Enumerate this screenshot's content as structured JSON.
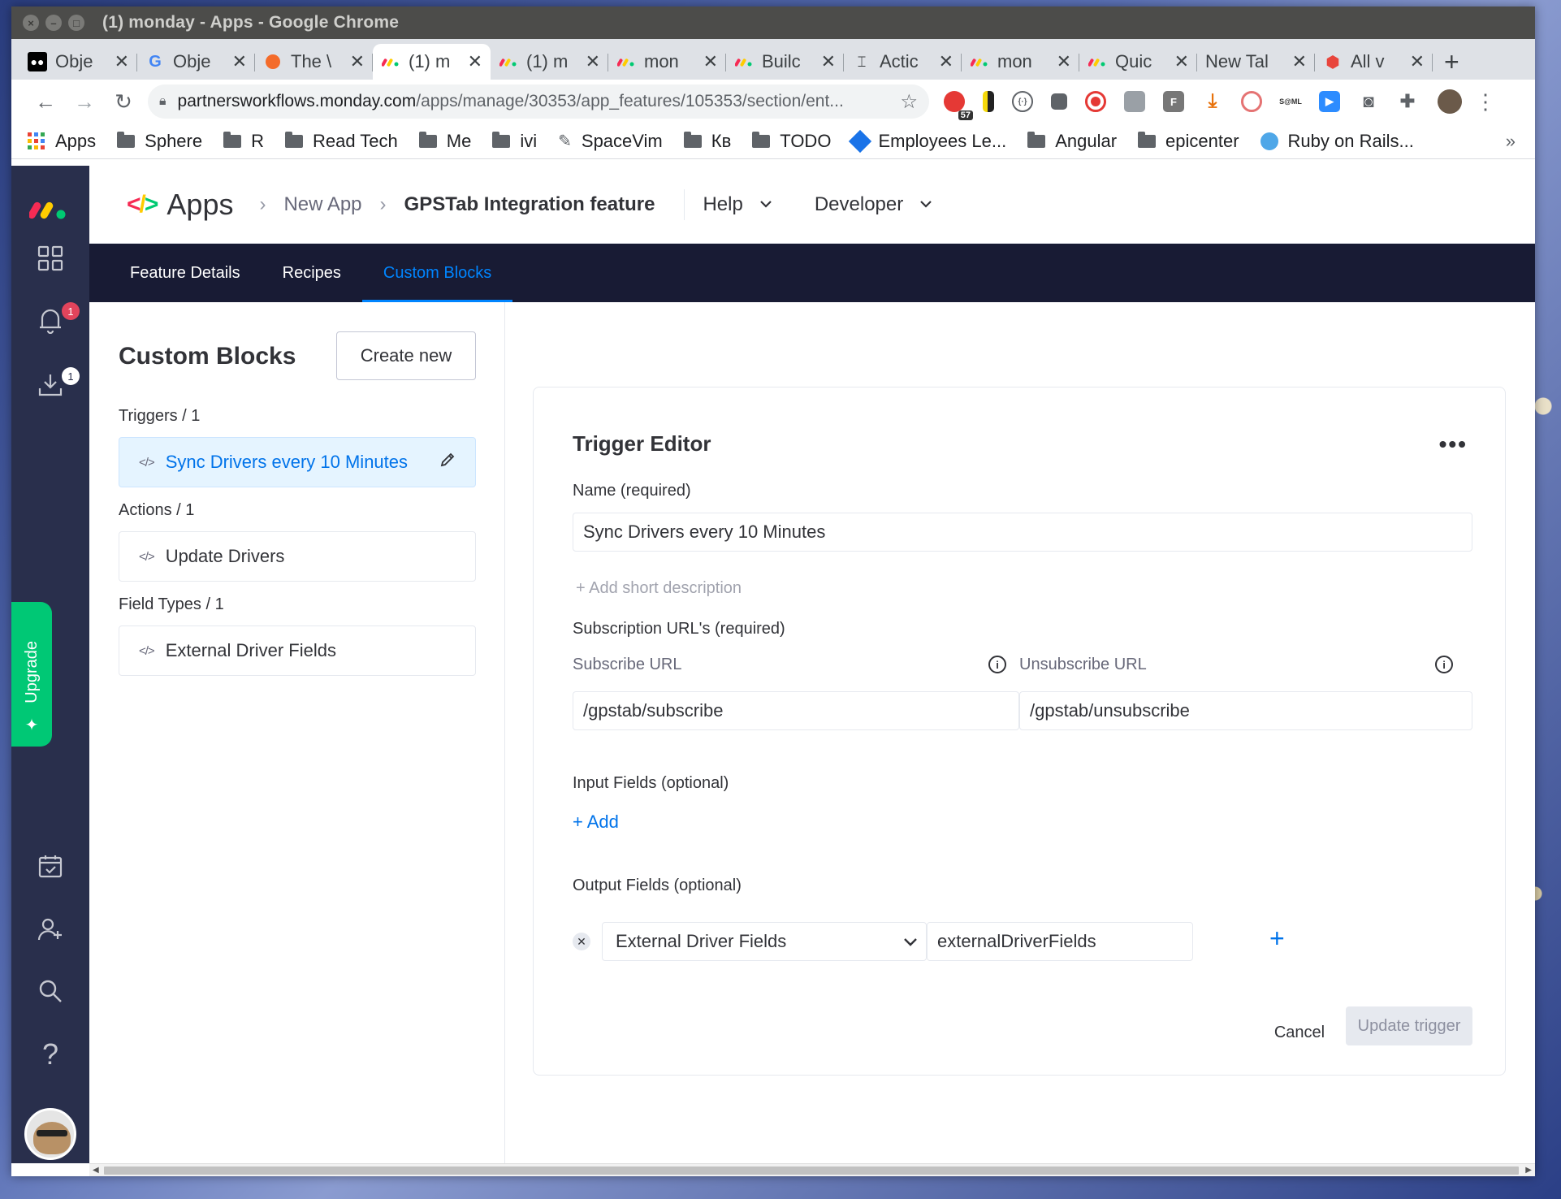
{
  "window": {
    "title": "(1) monday - Apps - Google Chrome"
  },
  "tabs": [
    {
      "label": "Obje",
      "icon": "medium-icon",
      "active": false
    },
    {
      "label": "Obje",
      "icon": "google-icon",
      "active": false
    },
    {
      "label": "The \\",
      "icon": "the-icon",
      "active": false
    },
    {
      "label": "(1) m",
      "icon": "monday-icon",
      "active": true
    },
    {
      "label": "(1) m",
      "icon": "monday-icon",
      "active": false
    },
    {
      "label": "mon",
      "icon": "monday-icon",
      "active": false
    },
    {
      "label": "Builc",
      "icon": "monday-icon",
      "active": false
    },
    {
      "label": "Actic",
      "icon": "action-icon",
      "active": false
    },
    {
      "label": "mon",
      "icon": "monday-icon",
      "active": false
    },
    {
      "label": "Quic",
      "icon": "monday-icon",
      "active": false
    },
    {
      "label": "New Tal",
      "icon": "none",
      "active": false
    },
    {
      "label": "All v",
      "icon": "shield-icon",
      "active": false
    }
  ],
  "address": {
    "host": "partnersworkflows.monday.com",
    "path": "/apps/manage/30353/app_features/105353/section/ent..."
  },
  "extensions": {
    "badge_count": "57"
  },
  "bookmarks": [
    {
      "label": "Apps",
      "icon": "apps-grid-icon"
    },
    {
      "label": "Sphere",
      "icon": "folder-icon"
    },
    {
      "label": "R",
      "icon": "folder-icon"
    },
    {
      "label": "Read Tech",
      "icon": "folder-icon"
    },
    {
      "label": "Me",
      "icon": "folder-icon"
    },
    {
      "label": "ivi",
      "icon": "folder-icon"
    },
    {
      "label": "SpaceVim",
      "icon": "spacevim-icon"
    },
    {
      "label": "Кв",
      "icon": "folder-icon"
    },
    {
      "label": "TODO",
      "icon": "folder-icon"
    },
    {
      "label": "Employees Le...",
      "icon": "diamond-icon"
    },
    {
      "label": "Angular",
      "icon": "folder-icon"
    },
    {
      "label": "epicenter",
      "icon": "folder-icon"
    },
    {
      "label": "Ruby on Rails...",
      "icon": "cloud-icon"
    }
  ],
  "rail": {
    "notifications_badge": "1",
    "inbox_badge": "1",
    "upgrade_label": "Upgrade"
  },
  "header": {
    "apps_logo": "</>",
    "apps_title": "Apps",
    "breadcrumbs": [
      "New App",
      "GPSTab Integration feature"
    ],
    "help_label": "Help",
    "developer_label": "Developer"
  },
  "subnav": {
    "tabs": [
      "Feature Details",
      "Recipes",
      "Custom Blocks"
    ],
    "active_index": 2
  },
  "custom_blocks": {
    "title": "Custom Blocks",
    "create_new_label": "Create new",
    "groups": [
      {
        "label": "Triggers / 1",
        "items": [
          "Sync Drivers every 10 Minutes"
        ]
      },
      {
        "label": "Actions / 1",
        "items": [
          "Update Drivers"
        ]
      },
      {
        "label": "Field Types / 1",
        "items": [
          "External Driver Fields"
        ]
      }
    ],
    "code_glyph": "</>"
  },
  "editor": {
    "title": "Trigger Editor",
    "name_label": "Name (required)",
    "name_value": "Sync Drivers every 10 Minutes",
    "add_description": "+ Add short description",
    "subscription_label": "Subscription URL's (required)",
    "subscribe_label": "Subscribe URL",
    "subscribe_value": "/gpstab/subscribe",
    "unsubscribe_label": "Unsubscribe URL",
    "unsubscribe_value": "/gpstab/unsubscribe",
    "input_fields_label": "Input Fields (optional)",
    "add_label": "+ Add",
    "output_fields_label": "Output Fields (optional)",
    "output_type": "External Driver Fields",
    "output_key": "externalDriverFields",
    "cancel_label": "Cancel",
    "update_label": "Update trigger"
  },
  "colors": {
    "rail_bg": "#292f4c",
    "subnav_bg": "#181b34",
    "accent": "#0073ea",
    "upgrade": "#00c875",
    "badge": "#e2445c"
  }
}
